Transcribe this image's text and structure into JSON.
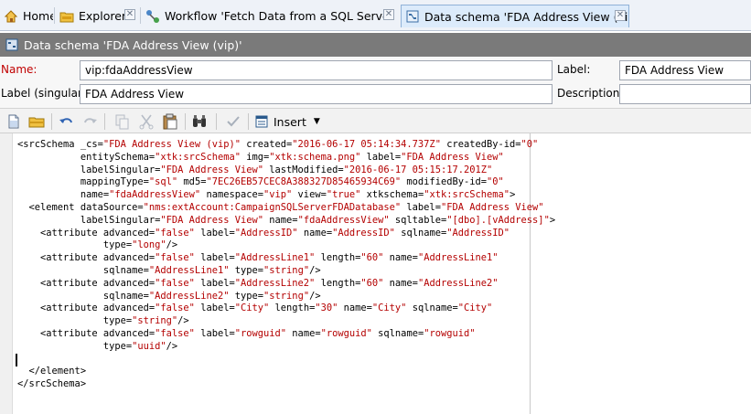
{
  "tabs": [
    {
      "label": "Home",
      "icon": "home-icon"
    },
    {
      "label": "Explorer",
      "icon": "folder-icon"
    },
    {
      "label": "Workflow 'Fetch Data from a SQL Server V...",
      "icon": "workflow-icon"
    },
    {
      "label": "Data schema 'FDA Address View (vip)'",
      "icon": "schema-icon"
    }
  ],
  "title": "Data schema 'FDA Address View (vip)'",
  "form": {
    "name_label": "Name:",
    "name_value": "vip:fdaAddressView",
    "label_label": "Label:",
    "label_value": "FDA Address View",
    "singular_label": "Label (singular):",
    "singular_value": "FDA Address View",
    "description_label": "Description:",
    "description_value": ""
  },
  "toolbar": {
    "insert_label": "Insert"
  },
  "colors": {
    "value_red": "#b40000",
    "title_bar": "#7a7a7a",
    "active_tab": "#dcebfb",
    "required_label": "#c00000"
  },
  "code_lines": [
    [
      {
        "t": "<srcSchema _cs="
      },
      {
        "t": "\"FDA Address View (vip)\"",
        "v": 1
      },
      {
        "t": " created="
      },
      {
        "t": "\"2016-06-17 05:14:34.737Z\"",
        "v": 1
      },
      {
        "t": " createdBy-id="
      },
      {
        "t": "\"0\"",
        "v": 1
      }
    ],
    [
      {
        "t": "           entitySchema="
      },
      {
        "t": "\"xtk:srcSchema\"",
        "v": 1
      },
      {
        "t": " img="
      },
      {
        "t": "\"xtk:schema.png\"",
        "v": 1
      },
      {
        "t": " label="
      },
      {
        "t": "\"FDA Address View\"",
        "v": 1
      }
    ],
    [
      {
        "t": "           labelSingular="
      },
      {
        "t": "\"FDA Address View\"",
        "v": 1
      },
      {
        "t": " lastModified="
      },
      {
        "t": "\"2016-06-17 05:15:17.201Z\"",
        "v": 1
      }
    ],
    [
      {
        "t": "           mappingType="
      },
      {
        "t": "\"sql\"",
        "v": 1
      },
      {
        "t": " md5="
      },
      {
        "t": "\"7EC26EB57CEC8A388327D85465934C69\"",
        "v": 1
      },
      {
        "t": " modifiedBy-id="
      },
      {
        "t": "\"0\"",
        "v": 1
      }
    ],
    [
      {
        "t": "           name="
      },
      {
        "t": "\"fdaAddressView\"",
        "v": 1
      },
      {
        "t": " namespace="
      },
      {
        "t": "\"vip\"",
        "v": 1
      },
      {
        "t": " view="
      },
      {
        "t": "\"true\"",
        "v": 1
      },
      {
        "t": " xtkschema="
      },
      {
        "t": "\"xtk:srcSchema\"",
        "v": 1
      },
      {
        "t": ">"
      }
    ],
    [
      {
        "t": "  <element dataSource="
      },
      {
        "t": "\"nms:extAccount:CampaignSQLServerFDADatabase\"",
        "v": 1
      },
      {
        "t": " label="
      },
      {
        "t": "\"FDA Address View\"",
        "v": 1
      }
    ],
    [
      {
        "t": "           labelSingular="
      },
      {
        "t": "\"FDA Address View\"",
        "v": 1
      },
      {
        "t": " name="
      },
      {
        "t": "\"fdaAddressView\"",
        "v": 1
      },
      {
        "t": " sqltable="
      },
      {
        "t": "\"[dbo].[vAddress]\"",
        "v": 1
      },
      {
        "t": ">"
      }
    ],
    [
      {
        "t": "    <attribute advanced="
      },
      {
        "t": "\"false\"",
        "v": 1
      },
      {
        "t": " label="
      },
      {
        "t": "\"AddressID\"",
        "v": 1
      },
      {
        "t": " name="
      },
      {
        "t": "\"AddressID\"",
        "v": 1
      },
      {
        "t": " sqlname="
      },
      {
        "t": "\"AddressID\"",
        "v": 1
      }
    ],
    [
      {
        "t": "               type="
      },
      {
        "t": "\"long\"",
        "v": 1
      },
      {
        "t": "/>"
      }
    ],
    [
      {
        "t": "    <attribute advanced="
      },
      {
        "t": "\"false\"",
        "v": 1
      },
      {
        "t": " label="
      },
      {
        "t": "\"AddressLine1\"",
        "v": 1
      },
      {
        "t": " length="
      },
      {
        "t": "\"60\"",
        "v": 1
      },
      {
        "t": " name="
      },
      {
        "t": "\"AddressLine1\"",
        "v": 1
      }
    ],
    [
      {
        "t": "               sqlname="
      },
      {
        "t": "\"AddressLine1\"",
        "v": 1
      },
      {
        "t": " type="
      },
      {
        "t": "\"string\"",
        "v": 1
      },
      {
        "t": "/>"
      }
    ],
    [
      {
        "t": "    <attribute advanced="
      },
      {
        "t": "\"false\"",
        "v": 1
      },
      {
        "t": " label="
      },
      {
        "t": "\"AddressLine2\"",
        "v": 1
      },
      {
        "t": " length="
      },
      {
        "t": "\"60\"",
        "v": 1
      },
      {
        "t": " name="
      },
      {
        "t": "\"AddressLine2\"",
        "v": 1
      }
    ],
    [
      {
        "t": "               sqlname="
      },
      {
        "t": "\"AddressLine2\"",
        "v": 1
      },
      {
        "t": " type="
      },
      {
        "t": "\"string\"",
        "v": 1
      },
      {
        "t": "/>"
      }
    ],
    [
      {
        "t": "    <attribute advanced="
      },
      {
        "t": "\"false\"",
        "v": 1
      },
      {
        "t": " label="
      },
      {
        "t": "\"City\"",
        "v": 1
      },
      {
        "t": " length="
      },
      {
        "t": "\"30\"",
        "v": 1
      },
      {
        "t": " name="
      },
      {
        "t": "\"City\"",
        "v": 1
      },
      {
        "t": " sqlname="
      },
      {
        "t": "\"City\"",
        "v": 1
      }
    ],
    [
      {
        "t": "               type="
      },
      {
        "t": "\"string\"",
        "v": 1
      },
      {
        "t": "/>"
      }
    ],
    [
      {
        "t": "    <attribute advanced="
      },
      {
        "t": "\"false\"",
        "v": 1
      },
      {
        "t": " label="
      },
      {
        "t": "\"rowguid\"",
        "v": 1
      },
      {
        "t": " name="
      },
      {
        "t": "\"rowguid\"",
        "v": 1
      },
      {
        "t": " sqlname="
      },
      {
        "t": "\"rowguid\"",
        "v": 1
      }
    ],
    [
      {
        "t": "               type="
      },
      {
        "t": "\"uuid\"",
        "v": 1
      },
      {
        "t": "/>"
      }
    ],
    [
      {
        "t": ""
      }
    ],
    [
      {
        "t": "  </element>"
      }
    ],
    [
      {
        "t": "</srcSchema>"
      }
    ]
  ]
}
